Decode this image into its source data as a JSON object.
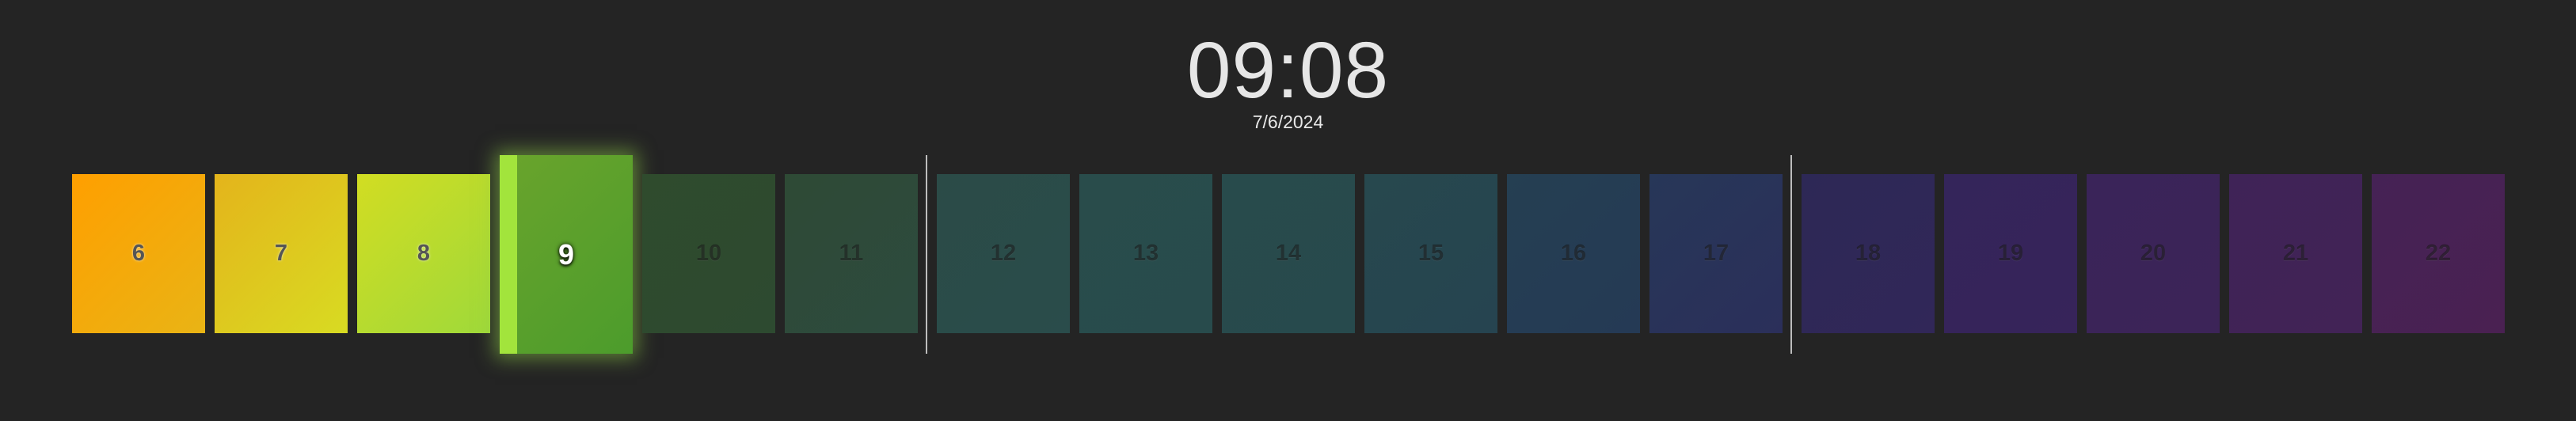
{
  "clock": {
    "time": "09:08",
    "date": "7/6/2024"
  },
  "current_hour_progress": 0.133,
  "hours": [
    {
      "label": "6",
      "state": "past",
      "color_from": "#ff9f00",
      "color_to": "#e9b415"
    },
    {
      "label": "7",
      "state": "past",
      "color_from": "#e4b41b",
      "color_to": "#d8db22"
    },
    {
      "label": "8",
      "state": "past",
      "color_from": "#d2dd22",
      "color_to": "#9fd93a"
    },
    {
      "label": "9",
      "state": "current",
      "color_from": "#6aa42c",
      "color_to": "#4c9c2c"
    },
    {
      "label": "10",
      "state": "future",
      "color_from": "#2f4b2d",
      "color_to": "#2d4a30"
    },
    {
      "label": "11",
      "state": "future",
      "color_from": "#2e4a35",
      "color_to": "#2d4b3f"
    },
    {
      "label": "12",
      "state": "future",
      "color_from": "#2b4b47",
      "color_to": "#2a4c4b"
    },
    {
      "label": "13",
      "state": "future",
      "color_from": "#294c4b",
      "color_to": "#284b4c"
    },
    {
      "label": "14",
      "state": "future",
      "color_from": "#284b4c",
      "color_to": "#274a4d"
    },
    {
      "label": "15",
      "state": "future",
      "color_from": "#27484e",
      "color_to": "#264450"
    },
    {
      "label": "16",
      "state": "future",
      "color_from": "#253f52",
      "color_to": "#253a55"
    },
    {
      "label": "17",
      "state": "future",
      "color_from": "#273758",
      "color_to": "#2b2f5a"
    },
    {
      "label": "18",
      "state": "future",
      "color_from": "#2d2856",
      "color_to": "#312758"
    },
    {
      "label": "19",
      "state": "future",
      "color_from": "#34255a",
      "color_to": "#37245a"
    },
    {
      "label": "20",
      "state": "future",
      "color_from": "#3a2459",
      "color_to": "#3c2458"
    },
    {
      "label": "21",
      "state": "future",
      "color_from": "#3f2357",
      "color_to": "#422356"
    },
    {
      "label": "22",
      "state": "future",
      "color_from": "#452255",
      "color_to": "#4a2152"
    }
  ],
  "dividers_after_labels": [
    "11",
    "17"
  ]
}
